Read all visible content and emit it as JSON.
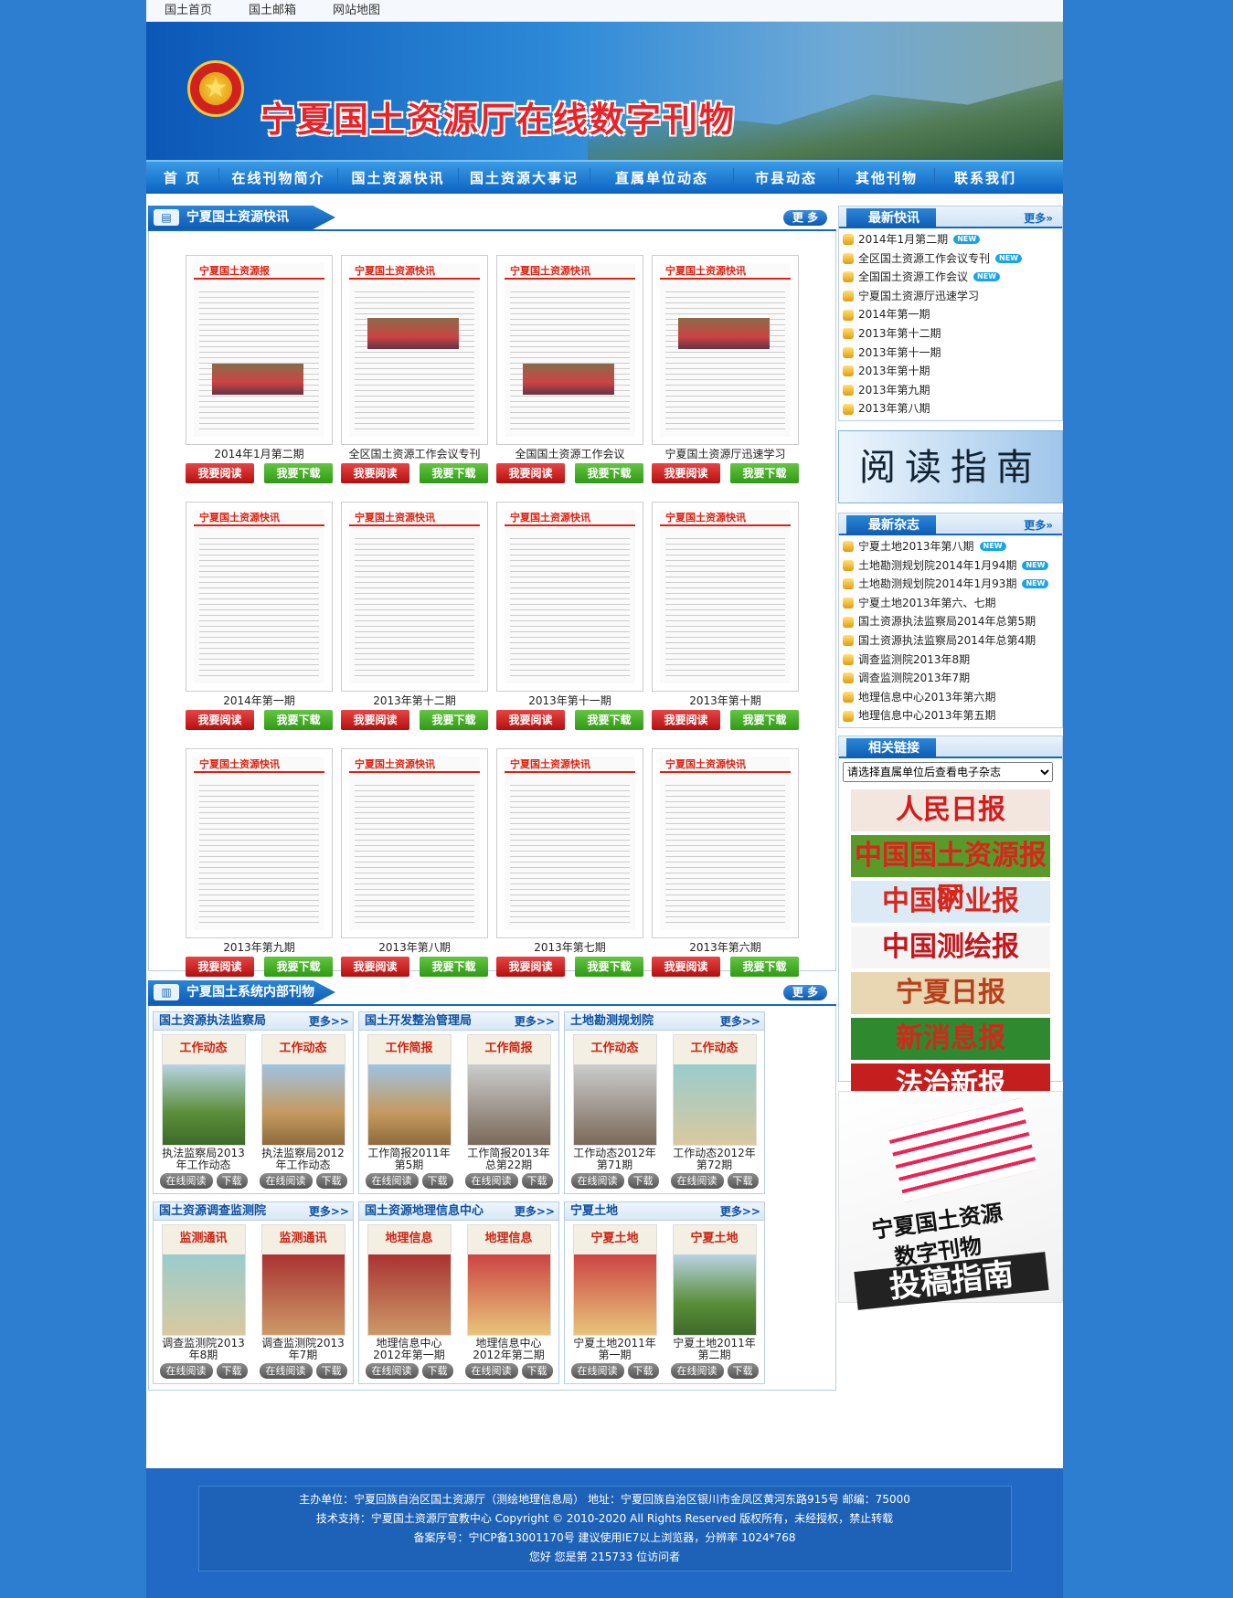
{
  "topbar": {
    "links": [
      "国土首页",
      "国土邮箱",
      "网站地图"
    ]
  },
  "banner": {
    "title": "宁夏国土资源厅在线数字刊物"
  },
  "nav": {
    "items": [
      "首 页",
      "在线刊物简介",
      "国土资源快讯",
      "国土资源大事记",
      "直属单位动态",
      "市县动态",
      "其他刊物",
      "联系我们"
    ]
  },
  "news_section": {
    "title": "宁夏国土资源快讯",
    "more": "更 多",
    "read_label": "我要阅读",
    "download_label": "我要下载",
    "items": [
      {
        "caption": "2014年1月第二期",
        "mast": "宁夏国土资源报"
      },
      {
        "caption": "全区国土资源工作会议专刊",
        "mast": "宁夏国土资源快讯"
      },
      {
        "caption": "全国国土资源工作会议",
        "mast": "宁夏国土资源快讯"
      },
      {
        "caption": "宁夏国土资源厅迅速学习",
        "mast": "宁夏国土资源快讯"
      },
      {
        "caption": "2014年第一期",
        "mast": "宁夏国土资源快讯"
      },
      {
        "caption": "2013年第十二期",
        "mast": "宁夏国土资源快讯"
      },
      {
        "caption": "2013年第十一期",
        "mast": "宁夏国土资源快讯"
      },
      {
        "caption": "2013年第十期",
        "mast": "宁夏国土资源快讯"
      },
      {
        "caption": "2013年第九期",
        "mast": "宁夏国土资源快讯"
      },
      {
        "caption": "2013年第八期",
        "mast": "宁夏国土资源快讯"
      },
      {
        "caption": "2013年第七期",
        "mast": "宁夏国土资源快讯"
      },
      {
        "caption": "2013年第六期",
        "mast": "宁夏国土资源快讯"
      }
    ]
  },
  "internal_section": {
    "title": "宁夏国土系统内部刊物",
    "more": "更 多",
    "online_label": "在线阅读",
    "download_label": "下载",
    "box_more": "更多>>",
    "boxes": [
      {
        "title": "国土资源执法监察局",
        "mags": [
          {
            "caption": "执法监察局2013年工作动态",
            "mast": "工作动态"
          },
          {
            "caption": "执法监察局2012年工作动态",
            "mast": "工作动态"
          }
        ]
      },
      {
        "title": "国土开发整治管理局",
        "mags": [
          {
            "caption": "工作简报2011年第5期",
            "mast": "工作简报"
          },
          {
            "caption": "工作简报2013年总第22期",
            "mast": "工作简报"
          }
        ]
      },
      {
        "title": "土地勘测规划院",
        "mags": [
          {
            "caption": "工作动态2012年第71期",
            "mast": "工作动态"
          },
          {
            "caption": "工作动态2012年第72期",
            "mast": "工作动态"
          }
        ]
      },
      {
        "title": "国土资源调查监测院",
        "mags": [
          {
            "caption": "调查监测院2013年8期",
            "mast": "监测通讯"
          },
          {
            "caption": "调查监测院2013年7期",
            "mast": "监测通讯"
          }
        ]
      },
      {
        "title": "国土资源地理信息中心",
        "mags": [
          {
            "caption": "地理信息中心2012年第一期",
            "mast": "地理信息"
          },
          {
            "caption": "地理信息中心2012年第二期",
            "mast": "地理信息"
          }
        ]
      },
      {
        "title": "宁夏土地",
        "mags": [
          {
            "caption": "宁夏土地2011年第一期",
            "mast": "宁夏土地"
          },
          {
            "caption": "宁夏土地2011年第二期",
            "mast": "宁夏土地"
          }
        ]
      }
    ]
  },
  "latest_news": {
    "title": "最新快讯",
    "more": "更多»",
    "new_badge": "NEW",
    "items": [
      {
        "text": "2014年1月第二期",
        "new": true
      },
      {
        "text": "全区国土资源工作会议专刊",
        "new": true
      },
      {
        "text": "全国国土资源工作会议",
        "new": true
      },
      {
        "text": "宁夏国土资源厅迅速学习",
        "new": false
      },
      {
        "text": "2014年第一期",
        "new": false
      },
      {
        "text": "2013年第十二期",
        "new": false
      },
      {
        "text": "2013年第十一期",
        "new": false
      },
      {
        "text": "2013年第十期",
        "new": false
      },
      {
        "text": "2013年第九期",
        "new": false
      },
      {
        "text": "2013年第八期",
        "new": false
      }
    ]
  },
  "reading_guide": "阅读指南",
  "latest_mags": {
    "title": "最新杂志",
    "more": "更多»",
    "items": [
      {
        "text": "宁夏土地2013年第八期",
        "new": true
      },
      {
        "text": "土地勘测规划院2014年1月94期",
        "new": true
      },
      {
        "text": "土地勘测规划院2014年1月93期",
        "new": true
      },
      {
        "text": "宁夏土地2013年第六、七期",
        "new": false
      },
      {
        "text": "国土资源执法监察局2014年总第5期",
        "new": false
      },
      {
        "text": "国土资源执法监察局2014年总第4期",
        "new": false
      },
      {
        "text": "调查监测院2013年8期",
        "new": false
      },
      {
        "text": "调查监测院2013年7期",
        "new": false
      },
      {
        "text": "地理信息中心2013年第六期",
        "new": false
      },
      {
        "text": "地理信息中心2013年第五期",
        "new": false
      }
    ]
  },
  "related_links": {
    "title": "相关链接",
    "select_value": "请选择直属单位后查看电子杂志",
    "logos": [
      {
        "text": "人民日报",
        "color": "#d21d1d",
        "bg": "#f3e6df"
      },
      {
        "text": "中国国土资源报网",
        "color": "#d7261c",
        "bg": "#5a9a2a"
      },
      {
        "text": "中国矿业报",
        "color": "#d7261c",
        "bg": "#dceaf6"
      },
      {
        "text": "中国测绘报",
        "color": "#c3161c",
        "bg": "#f5f5f5"
      },
      {
        "text": "宁夏日报",
        "color": "#b8411b",
        "bg": "#e9d7b4"
      },
      {
        "text": "新消息报",
        "color": "#d7261c",
        "bg": "#2f8a2f"
      },
      {
        "text": "法治新报",
        "color": "#ffffff",
        "bg": "#c51e1e"
      }
    ]
  },
  "submission_guide": {
    "line1": "宁夏国土资源",
    "line2": "数字刊物",
    "line3": "投稿指南"
  },
  "footer": {
    "lines": [
      "主办单位：宁夏回族自治区国土资源厅（测绘地理信息局） 地址：宁夏回族自治区银川市金凤区黄河东路915号 邮编：75000",
      "技术支持：宁夏国土资源厅宣教中心 Copyright © 2010-2020 All Rights Reserved 版权所有，未经授权，禁止转载",
      "备案序号：宁ICP备13001170号 建议使用IE7以上浏览器，分辨率 1024*768",
      "您好 您是第 215733 位访问者"
    ]
  }
}
